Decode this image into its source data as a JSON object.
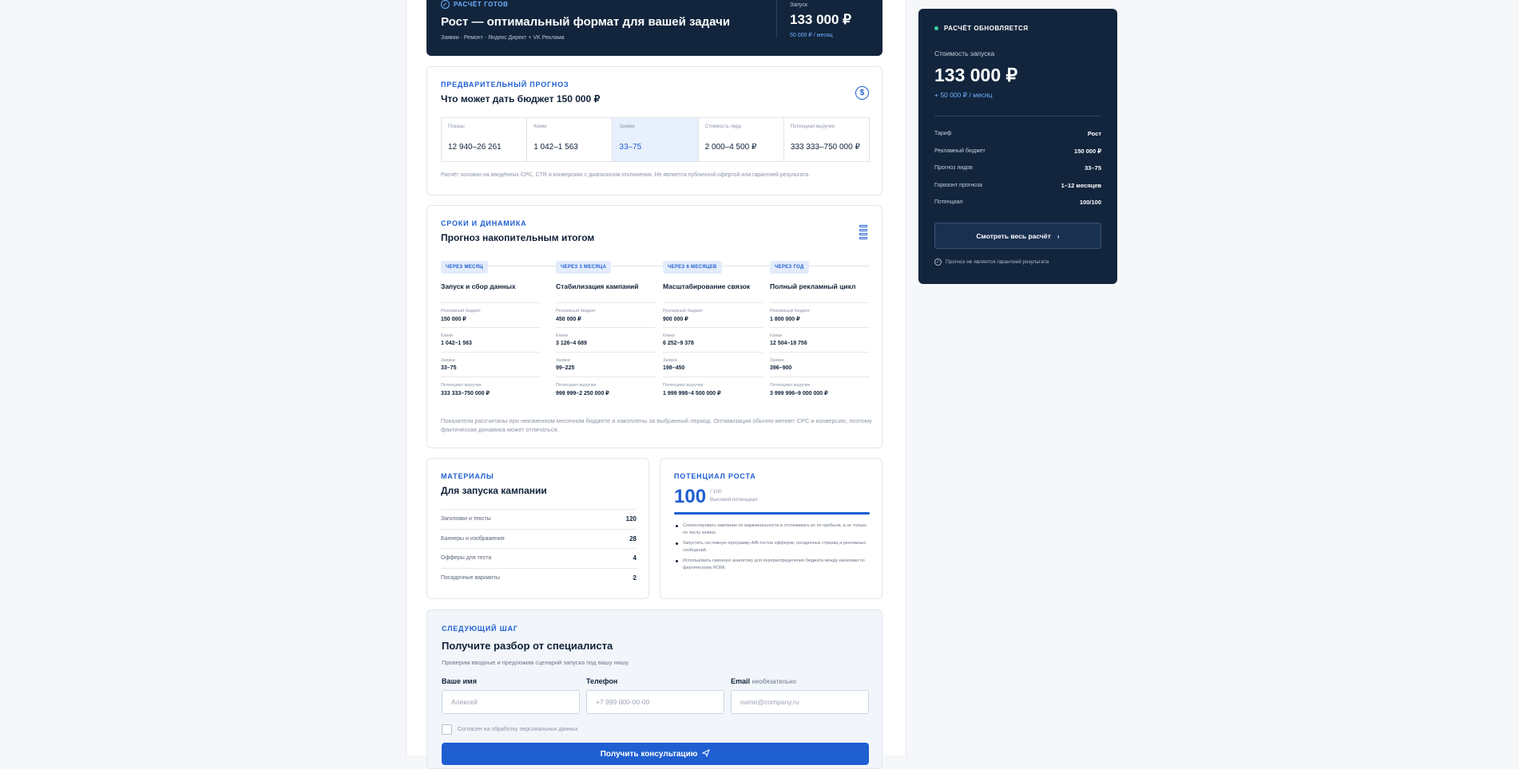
{
  "hero": {
    "badge": "РАСЧЁТ ГОТОВ",
    "title": "Рост — оптимальный формат для вашей задачи",
    "subtitle": "Заявки · Ремонт · Яндекс Директ + VK Реклама",
    "launch_label": "Запуск",
    "launch_value": "133 000 ₽",
    "launch_sub": "50 000 ₽ / месяц"
  },
  "forecast": {
    "eyebrow": "ПРЕДВАРИТЕЛЬНЫЙ ПРОГНОЗ",
    "title": "Что может дать бюджет 150 000 ₽",
    "metrics": [
      {
        "label": "Показы",
        "value": "12 940–26 261"
      },
      {
        "label": "Клики",
        "value": "1 042–1 563"
      },
      {
        "label": "Заявки",
        "value": "33–75"
      },
      {
        "label": "Стоимость лида",
        "value": "2 000–4 500 ₽"
      },
      {
        "label": "Потенциал выручки",
        "value": "333 333–750 000 ₽"
      }
    ],
    "note": "Расчёт основан на введённых CPC, CTR и конверсиях с диапазоном отклонения. Не является публичной офертой или гарантией результата."
  },
  "timeline": {
    "eyebrow": "СРОКИ И ДИНАМИКА",
    "title": "Прогноз накопительным итогом",
    "row_labels": {
      "budget": "Рекламный бюджет",
      "clicks": "Клики",
      "leads": "Заявки",
      "revenue": "Потенциал выручки"
    },
    "stages": [
      {
        "pill": "ЧЕРЕЗ МЕСЯЦ",
        "title": "Запуск и сбор данных",
        "budget": "150 000 ₽",
        "clicks": "1 042–1 563",
        "leads": "33–75",
        "revenue": "333 333–750 000 ₽"
      },
      {
        "pill": "ЧЕРЕЗ 3 МЕСЯЦА",
        "title": "Стабилизация кампаний",
        "budget": "450 000 ₽",
        "clicks": "3 126–4 689",
        "leads": "99–225",
        "revenue": "999 999–2 250 000 ₽"
      },
      {
        "pill": "ЧЕРЕЗ 6 МЕСЯЦЕВ",
        "title": "Масштабирование связок",
        "budget": "900 000 ₽",
        "clicks": "6 252–9 378",
        "leads": "198–450",
        "revenue": "1 999 998–4 500 000 ₽"
      },
      {
        "pill": "ЧЕРЕЗ ГОД",
        "title": "Полный рекламный цикл",
        "budget": "1 800 000 ₽",
        "clicks": "12 504–18 756",
        "leads": "396–900",
        "revenue": "3 999 996–9 000 000 ₽"
      }
    ],
    "note": "Показатели рассчитаны при неизменном месячном бюджете и накоплены за выбранный период. Оптимизация обычно меняет CPC и конверсию, поэтому фактическая динамика может отличаться."
  },
  "materials": {
    "eyebrow": "МАТЕРИАЛЫ",
    "title": "Для запуска кампании",
    "items": [
      {
        "label": "Заголовки и тексты",
        "value": "120"
      },
      {
        "label": "Баннеры и изображения",
        "value": "28"
      },
      {
        "label": "Офферы для теста",
        "value": "4"
      },
      {
        "label": "Посадочные варианты",
        "value": "2"
      }
    ]
  },
  "growth": {
    "eyebrow": "ПОТЕНЦИАЛ РОСТА",
    "score": "100",
    "score_max": "/ 100",
    "score_label": "Высокий потенциал",
    "score_fraction": 1.0,
    "tips": [
      "Сегментировать кампании по маржинальности и отслеживать их по прибыли, а не только по числу заявок.",
      "Запустить системную программу A/B-тестов офферов, посадочных страниц и рекламных сообщений.",
      "Использовать сквозную аналитику для перераспределения бюджета между каналами по фактическому ROMI."
    ]
  },
  "nextstep": {
    "eyebrow": "СЛЕДУЮЩИЙ ШАГ",
    "title": "Получите разбор от специалиста",
    "desc": "Проверим вводные и предложим сценарий запуска под вашу нишу.",
    "name_label": "Ваше имя",
    "name_placeholder": "Алексей",
    "phone_label": "Телефон",
    "phone_placeholder": "+7 999 000-00-00",
    "email_label": "Email",
    "email_optional": "необязательно",
    "email_placeholder": "name@company.ru",
    "consent": "Согласен на обработку персональных данных",
    "submit": "Получить консультацию"
  },
  "summary": {
    "status": "РАСЧЁТ ОБНОВЛЯЕТСЯ",
    "cost_label": "Стоимость запуска",
    "cost_value": "133 000 ₽",
    "cost_sub": "+ 50 000 ₽ / месяц",
    "rows": [
      {
        "label": "Тариф",
        "value": "Рост"
      },
      {
        "label": "Рекламный бюджет",
        "value": "150 000 ₽"
      },
      {
        "label": "Прогноз лидов",
        "value": "33–75"
      },
      {
        "label": "Горизонт прогноза",
        "value": "1–12 месяцев"
      },
      {
        "label": "Потенциал",
        "value": "100/100"
      }
    ],
    "button": "Смотреть весь расчёт",
    "disclaimer": "Прогноз не является гарантией результата"
  },
  "colors": {
    "navy": "#12253d",
    "accent": "#1f5fd1",
    "status_dot": "#3ad0a0"
  }
}
